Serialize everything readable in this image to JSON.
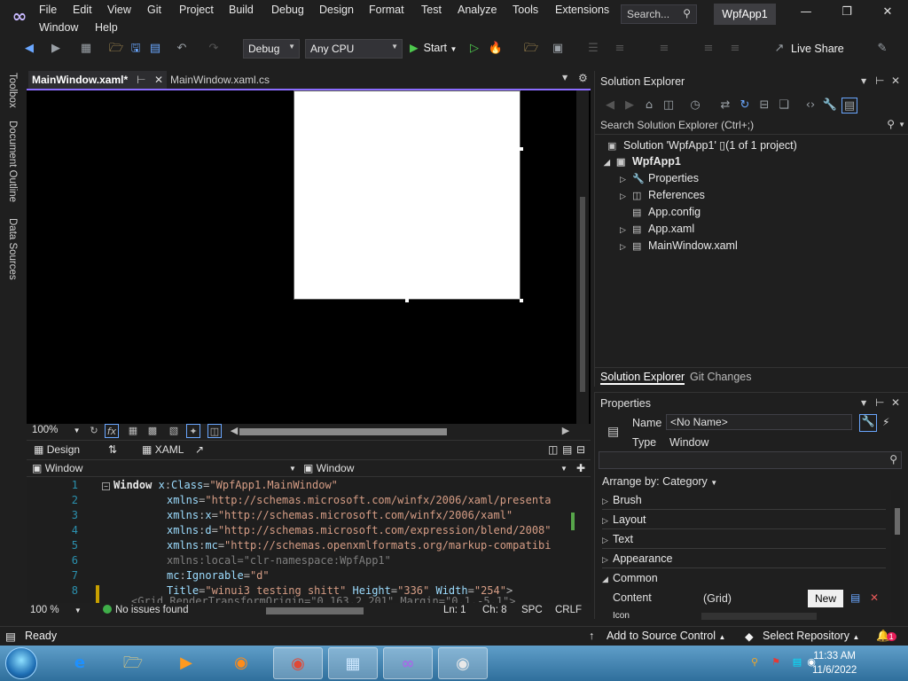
{
  "menu": {
    "items": [
      "File",
      "Edit",
      "View",
      "Git",
      "Project",
      "Build",
      "Debug",
      "Design",
      "Format",
      "Test",
      "Analyze",
      "Tools",
      "Extensions",
      "Window",
      "Help"
    ],
    "search_label": "Search...",
    "project_name": "WpfApp1"
  },
  "toolbar": {
    "configuration": "Debug",
    "platform": "Any CPU",
    "start_label": "Start",
    "live_share_label": "Live Share"
  },
  "side_tabs": [
    "Toolbox",
    "Document Outline",
    "Data Sources"
  ],
  "doc_tabs": {
    "active": "MainWindow.xaml*",
    "other": "MainWindow.xaml.cs"
  },
  "designer": {
    "zoom": "100%",
    "design_tab": "Design",
    "xaml_tab": "XAML",
    "nav_left": "Window",
    "nav_right": "Window"
  },
  "code": {
    "lines": [
      {
        "n": "1",
        "tokens": [
          [
            "el",
            "Window "
          ],
          [
            "at",
            "x"
          ],
          [
            "pun",
            ":"
          ],
          [
            "at",
            "Class"
          ],
          [
            "pun",
            "="
          ],
          [
            "val",
            "\"WpfApp1.MainWindow\""
          ]
        ]
      },
      {
        "n": "2",
        "tokens": [
          [
            "at",
            "xmlns"
          ],
          [
            "pun",
            "="
          ],
          [
            "val",
            "\"http://schemas.microsoft.com/winfx/2006/xaml/presenta"
          ]
        ]
      },
      {
        "n": "3",
        "tokens": [
          [
            "at",
            "xmlns"
          ],
          [
            "pun",
            ":"
          ],
          [
            "at",
            "x"
          ],
          [
            "pun",
            "="
          ],
          [
            "val",
            "\"http://schemas.microsoft.com/winfx/2006/xaml\""
          ]
        ]
      },
      {
        "n": "4",
        "tokens": [
          [
            "at",
            "xmlns"
          ],
          [
            "pun",
            ":"
          ],
          [
            "at",
            "d"
          ],
          [
            "pun",
            "="
          ],
          [
            "val",
            "\"http://schemas.microsoft.com/expression/blend/2008\""
          ]
        ]
      },
      {
        "n": "5",
        "tokens": [
          [
            "at",
            "xmlns"
          ],
          [
            "pun",
            ":"
          ],
          [
            "at",
            "mc"
          ],
          [
            "pun",
            "="
          ],
          [
            "val",
            "\"http://schemas.openxmlformats.org/markup-compatibi"
          ]
        ]
      },
      {
        "n": "6",
        "tokens": [
          [
            "dim",
            "xmlns:local=\"clr-namespace:WpfApp1\""
          ]
        ]
      },
      {
        "n": "7",
        "tokens": [
          [
            "at",
            "mc"
          ],
          [
            "pun",
            ":"
          ],
          [
            "at",
            "Ignorable"
          ],
          [
            "pun",
            "="
          ],
          [
            "val",
            "\"d\""
          ]
        ]
      },
      {
        "n": "8",
        "tokens": [
          [
            "at",
            "Title"
          ],
          [
            "pun",
            "="
          ],
          [
            "val",
            "\"winui3 testing shitt\" "
          ],
          [
            "at",
            "Height"
          ],
          [
            "pun",
            "="
          ],
          [
            "val",
            "\"336\" "
          ],
          [
            "at",
            "Width"
          ],
          [
            "pun",
            "="
          ],
          [
            "val",
            "\"254\""
          ],
          [
            "pun",
            ">"
          ]
        ]
      }
    ],
    "partial_line": "<Grid RenderTransformOrigin=\"0.163,2.201\" Margin=\"0,1,-5,1\">"
  },
  "editor_status": {
    "zoom": "100 %",
    "issues": "No issues found",
    "line": "Ln: 1",
    "col": "Ch: 8",
    "spc": "SPC",
    "eol": "CRLF"
  },
  "solution_explorer": {
    "title": "Solution Explorer",
    "search_placeholder": "Search Solution Explorer (Ctrl+;)",
    "solution": "Solution 'WpfApp1' ▯(1 of 1 project)",
    "project": "WpfApp1",
    "items": [
      {
        "label": "Properties",
        "icon": "wrench-icon",
        "expandable": true
      },
      {
        "label": "References",
        "icon": "references-icon",
        "expandable": true
      },
      {
        "label": "App.config",
        "icon": "config-file-icon",
        "expandable": false
      },
      {
        "label": "App.xaml",
        "icon": "xaml-file-icon",
        "expandable": true
      },
      {
        "label": "MainWindow.xaml",
        "icon": "xaml-file-icon",
        "expandable": true
      }
    ],
    "tab_active": "Solution Explorer",
    "tab_other": "Git Changes"
  },
  "properties": {
    "title": "Properties",
    "name_label": "Name",
    "name_value": "<No Name>",
    "type_label": "Type",
    "type_value": "Window",
    "arrange_by": "Arrange by: Category",
    "categories": [
      {
        "label": "Brush",
        "expanded": false
      },
      {
        "label": "Layout",
        "expanded": false
      },
      {
        "label": "Text",
        "expanded": false
      },
      {
        "label": "Appearance",
        "expanded": false
      },
      {
        "label": "Common",
        "expanded": true
      }
    ],
    "content_label": "Content",
    "content_value": "(Grid)",
    "new_button": "New",
    "icon_label": "Icon"
  },
  "status_bar": {
    "ready": "Ready",
    "add_source": "Add to Source Control",
    "select_repo": "Select Repository",
    "notifications": "1"
  },
  "taskbar": {
    "time": "11:33 AM",
    "date": "11/6/2022"
  }
}
